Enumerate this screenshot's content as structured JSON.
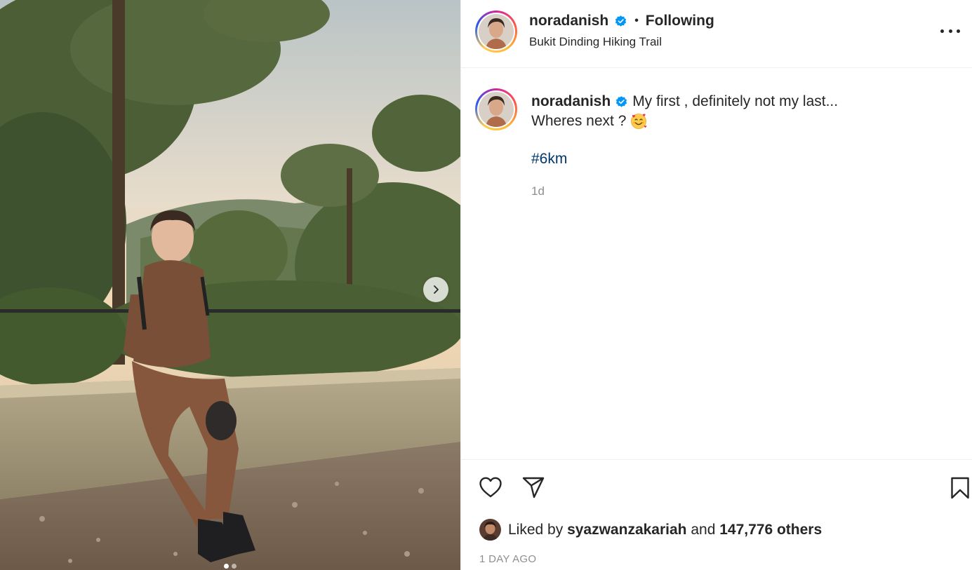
{
  "post": {
    "username": "noradanish",
    "follow_status": "Following",
    "separator": "•",
    "location": "Bukit Dinding Hiking Trail",
    "caption_line1": "My first , definitely not my last...",
    "caption_line2": "Wheres next ?",
    "caption_emoji": "smiling-face-with-hearts-emoji",
    "hashtag": "#6km",
    "relative_time": "1d",
    "liked_by_prefix": "Liked by",
    "liked_by_user": "syazwanzakariah",
    "liked_by_and": "and",
    "liked_by_others": "147,776 others",
    "date_full": "1 DAY AGO"
  },
  "carousel": {
    "current_slide": 1,
    "total_slides": 2,
    "next_icon": "chevron-right-icon"
  },
  "icons": {
    "verified": "verified-badge-icon",
    "more": "more-options-icon",
    "like": "heart-icon",
    "share": "paper-plane-icon",
    "save": "bookmark-icon"
  },
  "colors": {
    "verified_blue": "#0095f6",
    "hashtag": "#00376b",
    "muted": "#8e8e8e",
    "text": "#262626",
    "divider": "#efefef"
  }
}
